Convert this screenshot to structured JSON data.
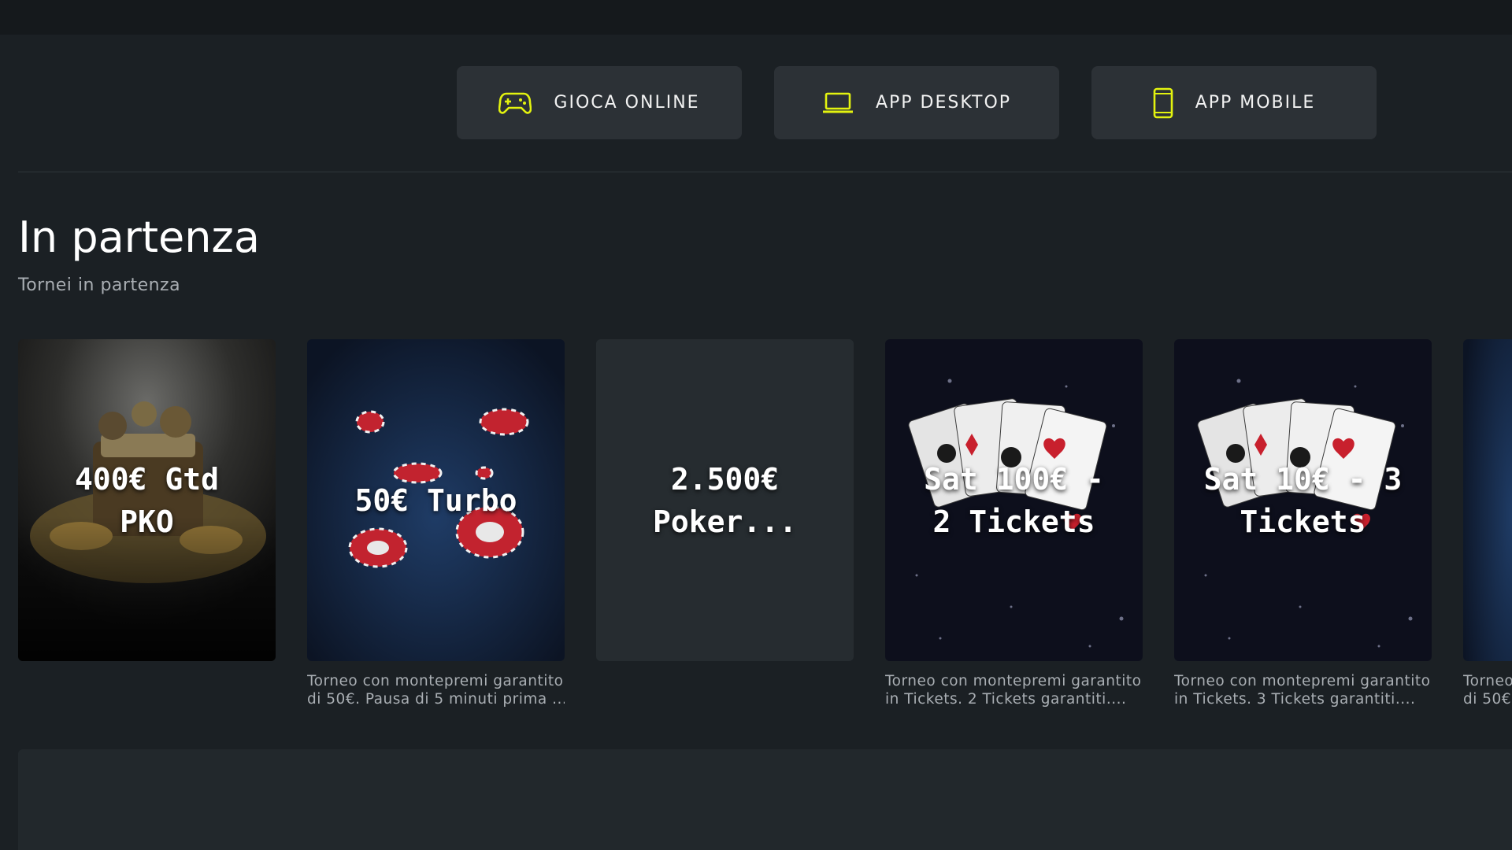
{
  "header": {
    "buttons": [
      {
        "label": "GIOCA ONLINE",
        "icon": "gamepad-icon"
      },
      {
        "label": "APP DESKTOP",
        "icon": "laptop-icon"
      },
      {
        "label": "APP MOBILE",
        "icon": "smartphone-icon"
      }
    ],
    "accent_color": "#e3f30f"
  },
  "section": {
    "title": "In partenza",
    "subtitle": "Tornei in partenza"
  },
  "tournaments": [
    {
      "title_line1": "400€ Gtd",
      "title_line2": "PKO",
      "desc_line1": "",
      "desc_line2": ""
    },
    {
      "title_line1": "50€ Turbo",
      "title_line2": "",
      "desc_line1": "Torneo con montepremi garantito",
      "desc_line2": "di 50€. Pausa di 5 minuti prima ..."
    },
    {
      "title_line1": "2.500€",
      "title_line2": " Poker...",
      "desc_line1": "",
      "desc_line2": ""
    },
    {
      "title_line1": "Sat 100€ -",
      "title_line2": "2 Tickets",
      "desc_line1": "Torneo con montepremi garantito",
      "desc_line2": "in Tickets. 2 Tickets garantiti...."
    },
    {
      "title_line1": "Sat 10€ - 3",
      "title_line2": "Tickets",
      "desc_line1": "Torneo con montepremi garantito",
      "desc_line2": "in Tickets. 3 Tickets garantiti...."
    },
    {
      "title_line1": "",
      "title_line2": "",
      "desc_line1": "Torneo",
      "desc_line2": "di 50€"
    }
  ]
}
